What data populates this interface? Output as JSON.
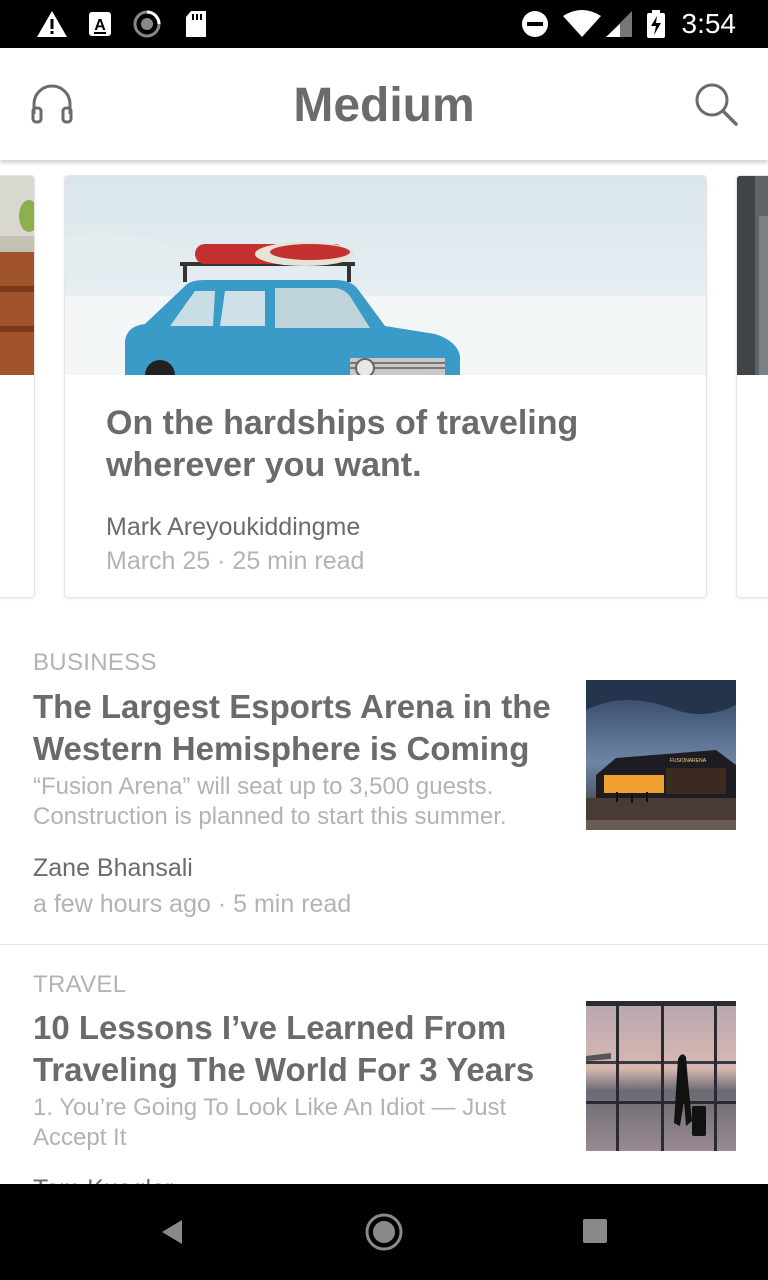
{
  "status_bar": {
    "time": "3:54",
    "icons": [
      "warning-icon",
      "text-a-icon",
      "sync-icon",
      "sd-card-icon",
      "do-not-disturb-icon",
      "wifi-icon",
      "signal-icon",
      "battery-charging-icon"
    ]
  },
  "app_bar": {
    "title": "Medium",
    "left_icon": "headphones-icon",
    "right_icon": "search-icon"
  },
  "featured": {
    "title": "On the hardships of traveling wherever you want.",
    "author": "Mark Areyoukiddingme",
    "meta": "March 25 · 25 min read"
  },
  "articles": [
    {
      "category": "BUSINESS",
      "title": "The Largest Esports Arena in the Western Hemisphere is Coming",
      "subtitle": "“Fusion Arena” will seat up to 3,500 guests. Construction is planned to start this summer.",
      "author": "Zane Bhansali",
      "meta": "a few hours ago · 5 min read",
      "thumb_sign": "FUSIONARENA"
    },
    {
      "category": "TRAVEL",
      "title": "10 Lessons I’ve Learned From Traveling The World For 3 Years",
      "subtitle": "1. You’re Going To Look Like An Idiot — Just Accept It",
      "author": "Tom Kuegler"
    }
  ],
  "nav_bar": {
    "buttons": [
      "back-icon",
      "home-icon",
      "recents-icon"
    ]
  },
  "colors": {
    "title_gray": "#6b6b6b",
    "meta_gray": "#b3b3b3",
    "status_bar": "#000000"
  }
}
